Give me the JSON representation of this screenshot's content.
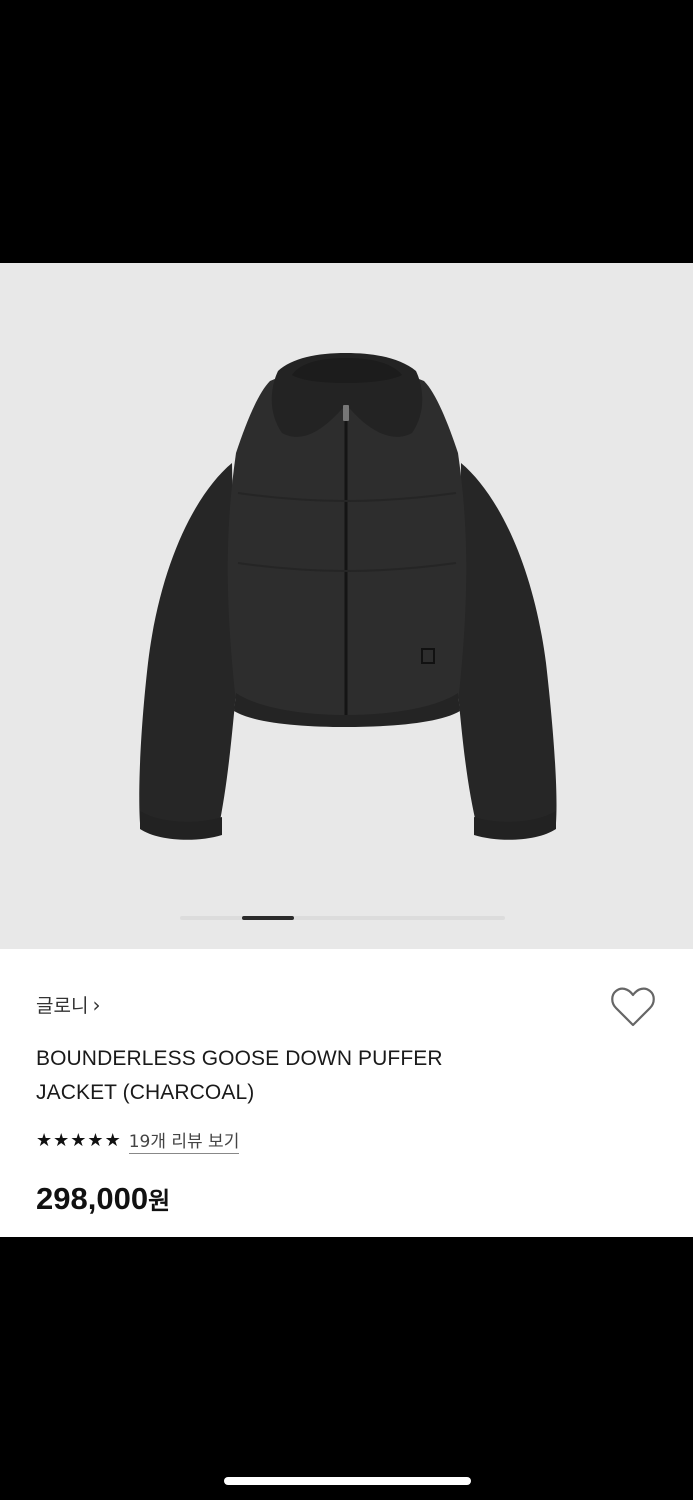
{
  "product": {
    "image_alt": "BOUNDERLESS GOOSE DOWN PUFFER JACKET (CHARCOAL)",
    "gallery_background": "#e8e8e8",
    "jacket_color": "#2a2a2a"
  },
  "gallery": {
    "current_slide": 1,
    "total_slides": 5
  },
  "brand": {
    "name": "글로니",
    "chevron": "›"
  },
  "title": {
    "line1": "BOUNDERLESS GOOSE DOWN PUFFER",
    "line2": "JACKET (CHARCOAL)"
  },
  "rating": {
    "stars": 5,
    "review_link": "19개 리뷰 보기"
  },
  "price": {
    "amount": "298,000",
    "unit": "원"
  },
  "icons": {
    "wishlist": "heart-outline-icon",
    "star": "star-icon"
  }
}
